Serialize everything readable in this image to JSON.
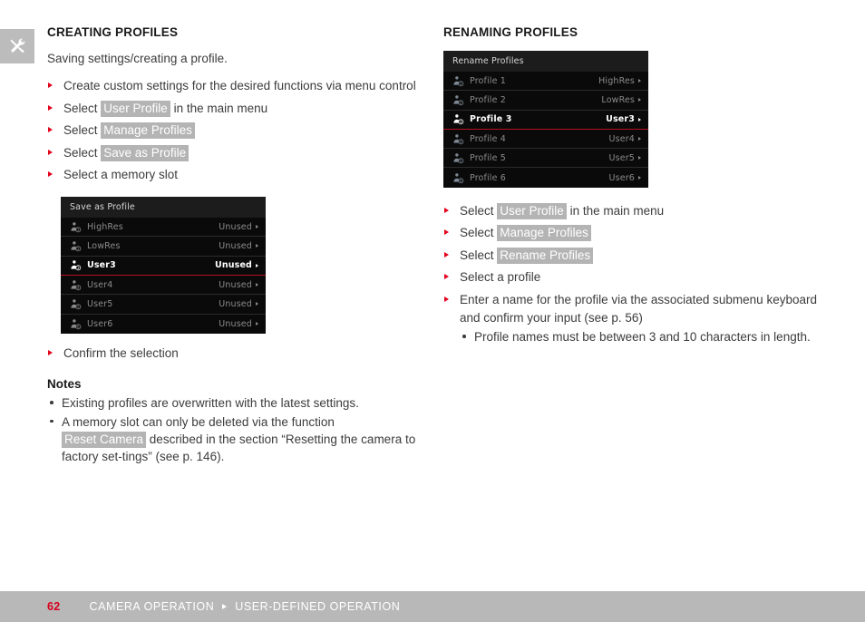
{
  "chapter_tab": {
    "icon": "tools-icon"
  },
  "left_column": {
    "title": "CREATING PROFILES",
    "lead": "Saving settings/creating a profile.",
    "steps": [
      {
        "pre": "Create custom settings for the desired functions via menu control",
        "chip": "",
        "post": ""
      },
      {
        "pre": "Select ",
        "chip": "User Profile",
        "post": " in the main menu"
      },
      {
        "pre": "Select ",
        "chip": "Manage Profiles",
        "post": ""
      },
      {
        "pre": "Select ",
        "chip": "Save as Profile",
        "post": ""
      },
      {
        "pre": "Select a memory slot",
        "chip": "",
        "post": ""
      }
    ],
    "confirm_step": "Confirm the selection",
    "notes_title": "Notes",
    "notes": [
      {
        "pre": "Existing profiles are overwritten with the latest settings.",
        "chip": "",
        "post": ""
      },
      {
        "pre": "A memory slot can only be deleted via the function ",
        "chip": "Reset Camera",
        "post": " described in the section “Resetting the camera to factory set-tings” (see p. 146)."
      }
    ],
    "screen": {
      "header": "Save as Profile",
      "rows": [
        {
          "badge": "1",
          "label": "HighRes",
          "value": "Unused",
          "selected": false
        },
        {
          "badge": "2",
          "label": "LowRes",
          "value": "Unused",
          "selected": false
        },
        {
          "badge": "3",
          "label": "User3",
          "value": "Unused",
          "selected": true
        },
        {
          "badge": "4",
          "label": "User4",
          "value": "Unused",
          "selected": false
        },
        {
          "badge": "5",
          "label": "User5",
          "value": "Unused",
          "selected": false
        },
        {
          "badge": "6",
          "label": "User6",
          "value": "Unused",
          "selected": false
        }
      ]
    }
  },
  "right_column": {
    "title": "RENAMING PROFILES",
    "screen": {
      "header": "Rename Profiles",
      "rows": [
        {
          "badge": "1",
          "label": "Profile 1",
          "value": "HighRes",
          "selected": false
        },
        {
          "badge": "2",
          "label": "Profile 2",
          "value": "LowRes",
          "selected": false
        },
        {
          "badge": "3",
          "label": "Profile 3",
          "value": "User3",
          "selected": true
        },
        {
          "badge": "4",
          "label": "Profile 4",
          "value": "User4",
          "selected": false
        },
        {
          "badge": "5",
          "label": "Profile 5",
          "value": "User5",
          "selected": false
        },
        {
          "badge": "6",
          "label": "Profile 6",
          "value": "User6",
          "selected": false
        }
      ]
    },
    "steps": [
      {
        "pre": "Select ",
        "chip": "User Profile",
        "post": " in the main menu"
      },
      {
        "pre": "Select ",
        "chip": "Manage Profiles",
        "post": ""
      },
      {
        "pre": "Select ",
        "chip": "Rename Profiles",
        "post": ""
      },
      {
        "pre": "Select a profile",
        "chip": "",
        "post": ""
      },
      {
        "pre": "Enter a name for the profile via the associated submenu keyboard and confirm your input (see p. 56)",
        "chip": "",
        "post": ""
      }
    ],
    "subnotes": [
      "Profile names must be between 3 and 10 characters in length."
    ]
  },
  "footer": {
    "page_number": "62",
    "breadcrumb_1": "CAMERA OPERATION",
    "breadcrumb_2": "USER-DEFINED OPERATION"
  },
  "colors": {
    "accent_red": "#e2001a",
    "footer_bg": "#b8b8b8",
    "chip_bg": "#b4b4b4",
    "screen_bg": "#0a0a0a",
    "selected_rule": "#b3121d"
  }
}
